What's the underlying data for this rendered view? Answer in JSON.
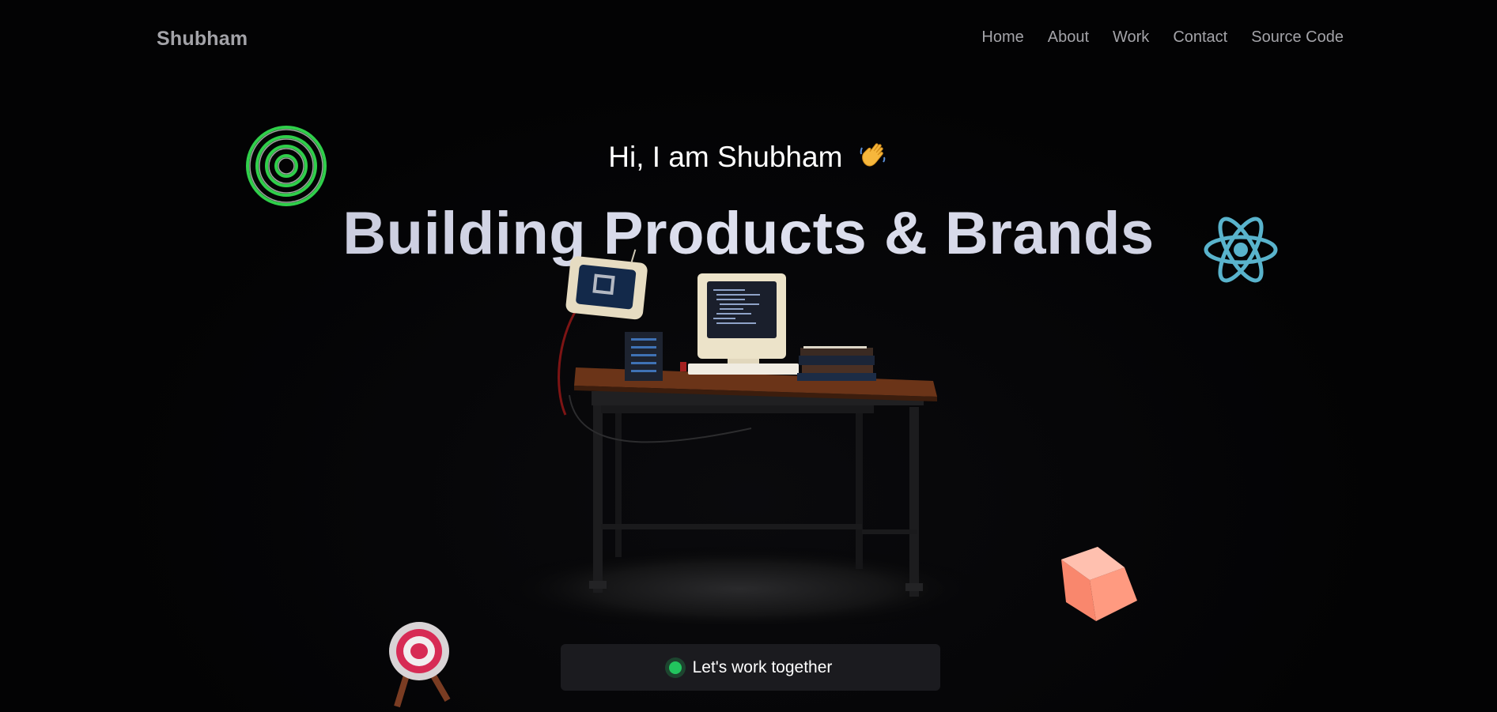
{
  "navbar": {
    "brand": "Shubham",
    "links": [
      {
        "label": "Home"
      },
      {
        "label": "About"
      },
      {
        "label": "Work"
      },
      {
        "label": "Contact"
      },
      {
        "label": "Source Code"
      }
    ]
  },
  "hero": {
    "greeting": "Hi, I am Shubham",
    "greeting_emoji": "waving-hand-icon",
    "headline": "Building Products & Brands"
  },
  "cta": {
    "label": "Let's work together",
    "status_color": "#22c55e"
  },
  "decorations": {
    "icons": [
      "concentric-rings-icon",
      "react-logo-icon",
      "cube-icon",
      "archery-target-icon",
      "retro-computer-desk-scene"
    ]
  },
  "colors": {
    "background": "#030304",
    "nav_text": "#a3a3a8",
    "headline": "#c9cce0",
    "cta_bg": "#1b1b1f"
  }
}
